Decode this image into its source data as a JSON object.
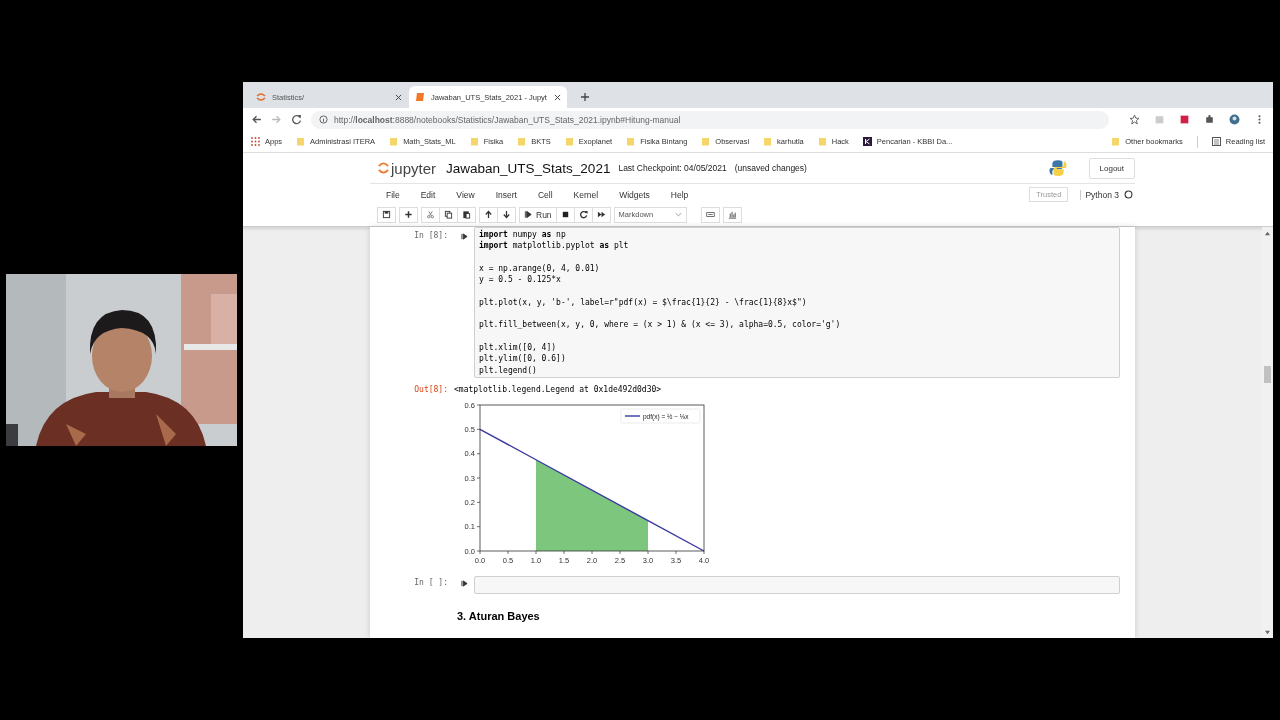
{
  "browser": {
    "tabs": [
      {
        "title": "Statistics/",
        "selected": false
      },
      {
        "title": "Jawaban_UTS_Stats_2021 - Jupyt",
        "selected": true
      }
    ],
    "url": "http://**localhost**:8888/notebooks/Statistics/Jawaban_UTS_Stats_2021.ipynb#Hitung-manual",
    "bookmarks": [
      {
        "kind": "apps",
        "label": "Apps"
      },
      {
        "kind": "folder",
        "label": "Administrasi ITERA"
      },
      {
        "kind": "folder",
        "label": "Math_Stats_ML"
      },
      {
        "kind": "folder",
        "label": "Fisika"
      },
      {
        "kind": "folder",
        "label": "BKTS"
      },
      {
        "kind": "folder",
        "label": "Exoplanet"
      },
      {
        "kind": "folder",
        "label": "Fisika Bintang"
      },
      {
        "kind": "folder",
        "label": "Observasi"
      },
      {
        "kind": "folder",
        "label": "karhutla"
      },
      {
        "kind": "folder",
        "label": "Hack"
      },
      {
        "kind": "site",
        "label": "Pencarian - KBBI Da..."
      }
    ],
    "other_bookmarks": "Other bookmarks",
    "reading_list": "Reading list"
  },
  "jupyter": {
    "logo_text": "jupyter",
    "notebook_name": "Jawaban_UTS_Stats_2021",
    "checkpoint": "Last Checkpoint: 04/05/2021",
    "save_status": "(unsaved changes)",
    "logout": "Logout",
    "menu": [
      "File",
      "Edit",
      "View",
      "Insert",
      "Cell",
      "Kernel",
      "Widgets",
      "Help"
    ],
    "trusted": "Trusted",
    "kernel": "Python 3",
    "run": "Run",
    "cell_type": "Markdown"
  },
  "cells": [
    {
      "kind": "code",
      "prompt": "In [8]:",
      "blocks": [
        [
          "**import** numpy **as** np",
          "**import** matplotlib.pyplot **as** plt"
        ],
        [
          "x = np.arange(0, 4, 0.01)",
          "y = 0.5 - 0.125*x"
        ],
        [
          "plt.plot(x, y, 'b-', label=r\"pdf(x) = $\\frac{1}{2} - \\frac{1}{8}x$\")"
        ],
        [
          "plt.fill_between(x, y, 0, where = (x > 1) & (x <= 3), alpha=0.5, color='g')"
        ],
        [
          "plt.xlim([0, 4])",
          "plt.ylim([0, 0.6])",
          "plt.legend()"
        ]
      ],
      "output_prompt": "Out[8]:",
      "output_text": "<matplotlib.legend.Legend at 0x1de492d0d30>",
      "chart_data": {
        "type": "line",
        "x": [
          0,
          1,
          3,
          4
        ],
        "series": [
          {
            "name": "pdf(x) = ½ − ⅛x",
            "type": "line",
            "color": "#3a3aa0",
            "values": [
              0.5,
              0.375,
              0.125,
              0
            ]
          },
          {
            "type": "area",
            "color": "#7dc67d",
            "values": [
              null,
              0.375,
              0.125,
              null
            ]
          }
        ],
        "xlim": [
          0,
          4
        ],
        "ylim": [
          0,
          0.6
        ],
        "xticks": [
          {
            "value": 0,
            "label": "0.0"
          },
          {
            "value": 0.5,
            "label": "0.5"
          },
          {
            "value": 1,
            "label": "1.0"
          },
          {
            "value": 1.5,
            "label": "1.5"
          },
          {
            "value": 2,
            "label": "2.0"
          },
          {
            "value": 2.5,
            "label": "2.5"
          },
          {
            "value": 3,
            "label": "3.0"
          },
          {
            "value": 3.5,
            "label": "3.5"
          },
          {
            "value": 4,
            "label": "4.0"
          }
        ],
        "yticks": [
          {
            "value": 0,
            "label": "0.0"
          },
          {
            "value": 0.1,
            "label": "0.1"
          },
          {
            "value": 0.2,
            "label": "0.2"
          },
          {
            "value": 0.3,
            "label": "0.3"
          },
          {
            "value": 0.4,
            "label": "0.4"
          },
          {
            "value": 0.5,
            "label": "0.5"
          },
          {
            "value": 0.6,
            "label": "0.6"
          }
        ]
      }
    },
    {
      "kind": "code",
      "prompt": "In [ ]:"
    },
    {
      "kind": "heading",
      "text": "3. Aturan Bayes"
    }
  ]
}
